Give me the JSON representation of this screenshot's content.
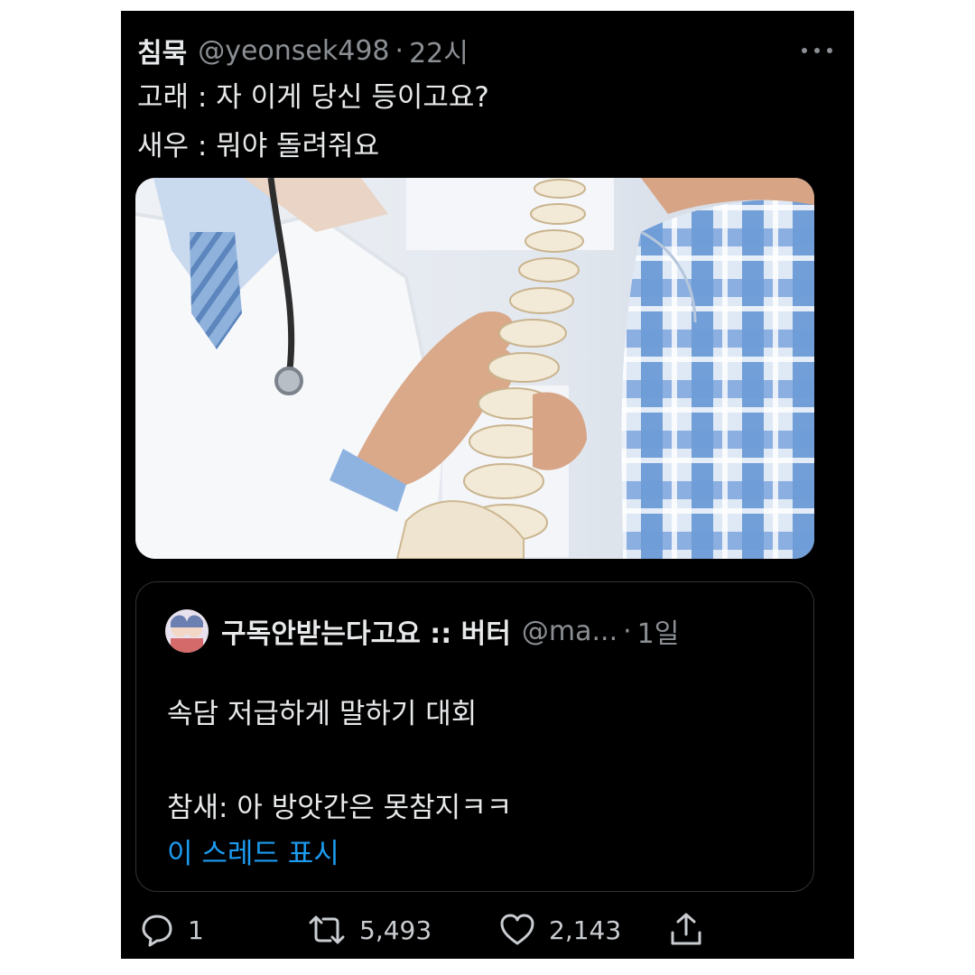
{
  "tweet": {
    "display_name": "침묵",
    "handle": "@yeonsek498",
    "separator": "·",
    "time": "22시",
    "lines": [
      "고래 : 자 이게 당신 등이고요?",
      "새우 : 뭐야 돌려줘요"
    ]
  },
  "quoted_tweet": {
    "display_name": "구독안받는다고요 :: 버터",
    "handle": "@ma...",
    "separator": "·",
    "time": "1일",
    "line1": "속담 저급하게 말하기 대회",
    "line2": "참새: 아 방앗간은 못참지ㅋㅋ",
    "show_thread": "이 스레드 표시"
  },
  "actions": {
    "reply_count": "1",
    "retweet_count": "5,493",
    "like_count": "2,143"
  },
  "icons": [
    "more-icon",
    "reply-icon",
    "retweet-icon",
    "like-icon",
    "share-icon"
  ],
  "colors": {
    "background": "#000000",
    "text": "#e7e9ea",
    "secondary": "#8b8f94",
    "link": "#1d9bf0"
  }
}
